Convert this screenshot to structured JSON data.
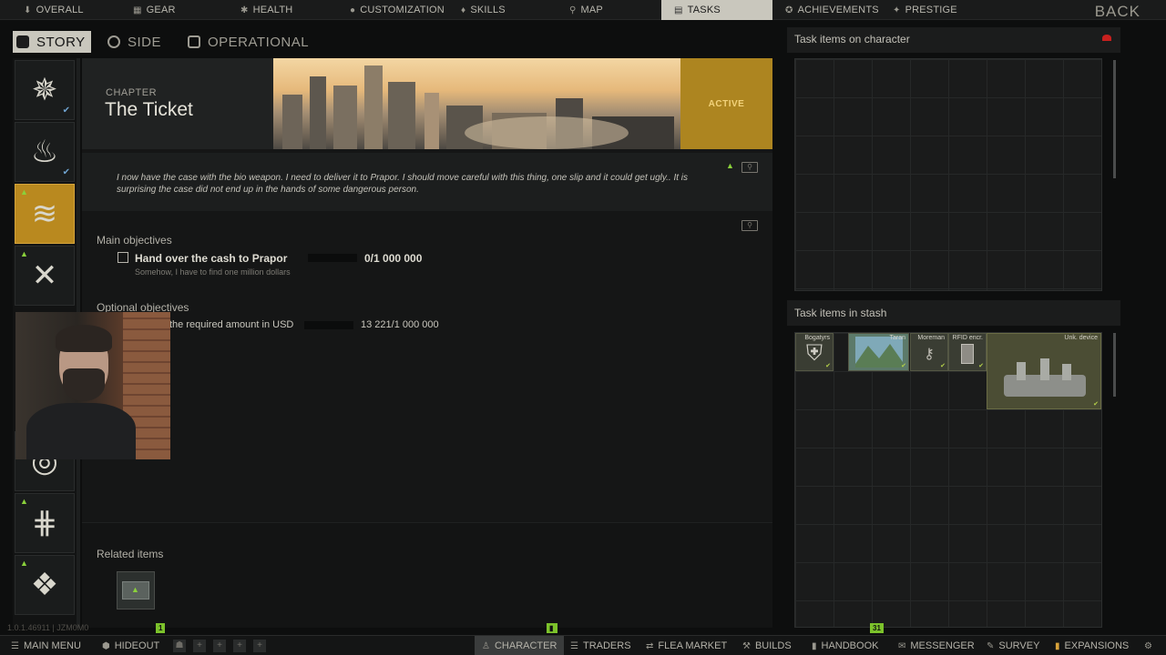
{
  "topnav": {
    "items": [
      {
        "label": "OVERALL",
        "icon": "overall-icon"
      },
      {
        "label": "GEAR",
        "icon": "gear-icon"
      },
      {
        "label": "HEALTH",
        "icon": "health-icon"
      },
      {
        "label": "CUSTOMIZATION",
        "icon": "customization-icon"
      },
      {
        "label": "SKILLS",
        "icon": "skills-icon"
      },
      {
        "label": "MAP",
        "icon": "map-icon"
      },
      {
        "label": "TASKS",
        "icon": "tasks-icon"
      },
      {
        "label": "ACHIEVEMENTS",
        "icon": "achievements-icon"
      },
      {
        "label": "PRESTIGE",
        "icon": "prestige-icon"
      }
    ],
    "active": "TASKS",
    "back_label": "BACK"
  },
  "subtabs": {
    "story": "STORY",
    "side": "SIDE",
    "operational": "OPERATIONAL"
  },
  "quest": {
    "chapter_label": "CHAPTER",
    "title": "The Ticket",
    "status": "ACTIVE",
    "description": "I now have the case with the bio weapon. I need to deliver it to Prapor. I should move careful with this thing, one slip and it could get ugly.. It is surprising the case did not end up in the hands of some dangerous person.",
    "main_objectives_heading": "Main objectives",
    "main_objectives": [
      {
        "text": "Hand over the cash to Prapor",
        "progress": "0/1 000 000",
        "hint": "Somehow, I have to find one million dollars"
      }
    ],
    "optional_objectives_heading": "Optional objectives",
    "optional_objectives": [
      {
        "text": "the required amount in USD",
        "progress": "13 221/1 000 000"
      }
    ],
    "related_items_heading": "Related items"
  },
  "right": {
    "character_heading": "Task items on character",
    "stash_heading": "Task items in stash",
    "stash_items": [
      {
        "label": "Bogatyrs"
      },
      {
        "label": "Taran"
      },
      {
        "label": "Moreman"
      },
      {
        "label": "RFID encr."
      },
      {
        "label": "Unk. device"
      }
    ]
  },
  "bottombar": {
    "main_menu": "MAIN MENU",
    "hideout": "HIDEOUT",
    "character": "CHARACTER",
    "traders": "TRADERS",
    "flea_market": "FLEA MARKET",
    "builds": "BUILDS",
    "handbook": "HANDBOOK",
    "messenger": "MESSENGER",
    "survey": "SURVEY",
    "expansions": "EXPANSIONS"
  },
  "badges": {
    "hideout": "1",
    "character": "",
    "messenger": "31"
  },
  "version": "1.0.1.46911 | JZM0M0",
  "colors": {
    "accent": "#ad8520",
    "active_tab": "#c9c7bd",
    "new_marker": "#8ad13b",
    "alert": "#c8201e"
  }
}
